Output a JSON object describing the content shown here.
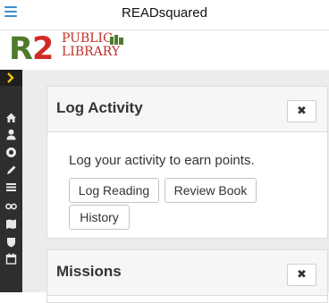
{
  "header": {
    "title": "READsquared",
    "menu_icon": "hamburger-icon"
  },
  "logo": {
    "r": "R",
    "two": "2",
    "line1": "PUBLIC",
    "line2": "LIBRARY",
    "colors": {
      "green": "#4f7b2c",
      "red": "#c0312a"
    }
  },
  "sidebar": {
    "items": [
      {
        "icon": "chevron-right-icon",
        "glyph": "›"
      },
      {
        "icon": "home-icon",
        "glyph": "⌂"
      },
      {
        "icon": "user-icon",
        "glyph": "●"
      },
      {
        "icon": "gear-icon",
        "glyph": "✻"
      },
      {
        "icon": "pencil-icon",
        "glyph": "✎"
      },
      {
        "icon": "list-icon",
        "glyph": "≡"
      },
      {
        "icon": "glasses-icon",
        "glyph": "∞"
      },
      {
        "icon": "map-icon",
        "glyph": "▥"
      },
      {
        "icon": "shield-icon",
        "glyph": "⛉"
      },
      {
        "icon": "calendar-icon",
        "glyph": "▦"
      }
    ]
  },
  "log_activity": {
    "title": "Log Activity",
    "description": "Log your activity to earn points.",
    "buttons": [
      "Log Reading",
      "Review Book",
      "History"
    ],
    "close_icon": "close-icon"
  },
  "missions": {
    "title": "Missions",
    "close_icon": "close-icon"
  }
}
